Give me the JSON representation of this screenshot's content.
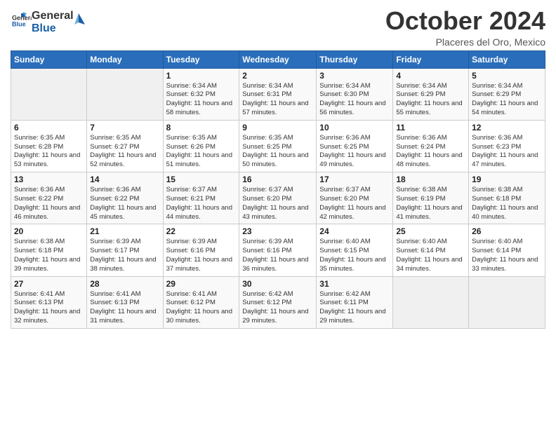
{
  "logo": {
    "line1": "General",
    "line2": "Blue",
    "icon_color": "#1a5fa8"
  },
  "header": {
    "month": "October 2024",
    "location": "Placeres del Oro, Mexico"
  },
  "weekdays": [
    "Sunday",
    "Monday",
    "Tuesday",
    "Wednesday",
    "Thursday",
    "Friday",
    "Saturday"
  ],
  "weeks": [
    [
      {
        "day": "",
        "empty": true
      },
      {
        "day": "",
        "empty": true
      },
      {
        "day": "1",
        "sunrise": "6:34 AM",
        "sunset": "6:32 PM",
        "daylight": "11 hours and 58 minutes."
      },
      {
        "day": "2",
        "sunrise": "6:34 AM",
        "sunset": "6:31 PM",
        "daylight": "11 hours and 57 minutes."
      },
      {
        "day": "3",
        "sunrise": "6:34 AM",
        "sunset": "6:30 PM",
        "daylight": "11 hours and 56 minutes."
      },
      {
        "day": "4",
        "sunrise": "6:34 AM",
        "sunset": "6:29 PM",
        "daylight": "11 hours and 55 minutes."
      },
      {
        "day": "5",
        "sunrise": "6:34 AM",
        "sunset": "6:29 PM",
        "daylight": "11 hours and 54 minutes."
      }
    ],
    [
      {
        "day": "6",
        "sunrise": "6:35 AM",
        "sunset": "6:28 PM",
        "daylight": "11 hours and 53 minutes."
      },
      {
        "day": "7",
        "sunrise": "6:35 AM",
        "sunset": "6:27 PM",
        "daylight": "11 hours and 52 minutes."
      },
      {
        "day": "8",
        "sunrise": "6:35 AM",
        "sunset": "6:26 PM",
        "daylight": "11 hours and 51 minutes."
      },
      {
        "day": "9",
        "sunrise": "6:35 AM",
        "sunset": "6:25 PM",
        "daylight": "11 hours and 50 minutes."
      },
      {
        "day": "10",
        "sunrise": "6:36 AM",
        "sunset": "6:25 PM",
        "daylight": "11 hours and 49 minutes."
      },
      {
        "day": "11",
        "sunrise": "6:36 AM",
        "sunset": "6:24 PM",
        "daylight": "11 hours and 48 minutes."
      },
      {
        "day": "12",
        "sunrise": "6:36 AM",
        "sunset": "6:23 PM",
        "daylight": "11 hours and 47 minutes."
      }
    ],
    [
      {
        "day": "13",
        "sunrise": "6:36 AM",
        "sunset": "6:22 PM",
        "daylight": "11 hours and 46 minutes."
      },
      {
        "day": "14",
        "sunrise": "6:36 AM",
        "sunset": "6:22 PM",
        "daylight": "11 hours and 45 minutes."
      },
      {
        "day": "15",
        "sunrise": "6:37 AM",
        "sunset": "6:21 PM",
        "daylight": "11 hours and 44 minutes."
      },
      {
        "day": "16",
        "sunrise": "6:37 AM",
        "sunset": "6:20 PM",
        "daylight": "11 hours and 43 minutes."
      },
      {
        "day": "17",
        "sunrise": "6:37 AM",
        "sunset": "6:20 PM",
        "daylight": "11 hours and 42 minutes."
      },
      {
        "day": "18",
        "sunrise": "6:38 AM",
        "sunset": "6:19 PM",
        "daylight": "11 hours and 41 minutes."
      },
      {
        "day": "19",
        "sunrise": "6:38 AM",
        "sunset": "6:18 PM",
        "daylight": "11 hours and 40 minutes."
      }
    ],
    [
      {
        "day": "20",
        "sunrise": "6:38 AM",
        "sunset": "6:18 PM",
        "daylight": "11 hours and 39 minutes."
      },
      {
        "day": "21",
        "sunrise": "6:39 AM",
        "sunset": "6:17 PM",
        "daylight": "11 hours and 38 minutes."
      },
      {
        "day": "22",
        "sunrise": "6:39 AM",
        "sunset": "6:16 PM",
        "daylight": "11 hours and 37 minutes."
      },
      {
        "day": "23",
        "sunrise": "6:39 AM",
        "sunset": "6:16 PM",
        "daylight": "11 hours and 36 minutes."
      },
      {
        "day": "24",
        "sunrise": "6:40 AM",
        "sunset": "6:15 PM",
        "daylight": "11 hours and 35 minutes."
      },
      {
        "day": "25",
        "sunrise": "6:40 AM",
        "sunset": "6:14 PM",
        "daylight": "11 hours and 34 minutes."
      },
      {
        "day": "26",
        "sunrise": "6:40 AM",
        "sunset": "6:14 PM",
        "daylight": "11 hours and 33 minutes."
      }
    ],
    [
      {
        "day": "27",
        "sunrise": "6:41 AM",
        "sunset": "6:13 PM",
        "daylight": "11 hours and 32 minutes."
      },
      {
        "day": "28",
        "sunrise": "6:41 AM",
        "sunset": "6:13 PM",
        "daylight": "11 hours and 31 minutes."
      },
      {
        "day": "29",
        "sunrise": "6:41 AM",
        "sunset": "6:12 PM",
        "daylight": "11 hours and 30 minutes."
      },
      {
        "day": "30",
        "sunrise": "6:42 AM",
        "sunset": "6:12 PM",
        "daylight": "11 hours and 29 minutes."
      },
      {
        "day": "31",
        "sunrise": "6:42 AM",
        "sunset": "6:11 PM",
        "daylight": "11 hours and 29 minutes."
      },
      {
        "day": "",
        "empty": true
      },
      {
        "day": "",
        "empty": true
      }
    ]
  ]
}
